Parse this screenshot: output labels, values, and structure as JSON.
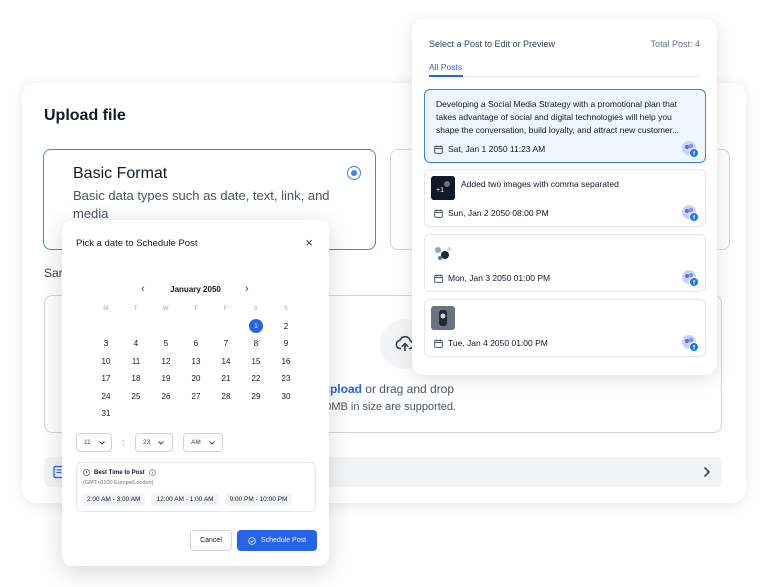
{
  "upload": {
    "title": "Upload file",
    "basic_format": {
      "name": "Basic Format",
      "description": "Basic data types such as date, text, link, and media"
    },
    "sample_label": "Sar",
    "dropzone": {
      "link_text": "o upload",
      "rest_text": " or drag and drop",
      "size_note": "o 50MB in size are supported."
    }
  },
  "posts": {
    "header_label": "Select a Post to Edit or Preview",
    "total_label": "Total Post: 4",
    "tab_all": "All Posts",
    "items": [
      {
        "text": "Developing a Social Media Strategy with a promotional plan that takes advantage of social and digital technologies will help you shape the conversation, build loyalty, and attract new customer...",
        "date": "Sat, Jan 1 2050 11:23 AM"
      },
      {
        "title": "Added two images with comma separated",
        "date": "Sun, Jan 2 2050 08:00 PM"
      },
      {
        "title": "",
        "date": "Mon, Jan 3 2050 01:00 PM"
      },
      {
        "title": "",
        "date": "Tue, Jan 4 2050 01:00 PM"
      }
    ],
    "thumb_badge": "+1"
  },
  "modal": {
    "title": "Pick a date to Schedule Post",
    "close": "×",
    "month": "January 2050",
    "weekdays": [
      "M",
      "T",
      "W",
      "T",
      "F",
      "S",
      "S"
    ],
    "weeks": [
      [
        "",
        "",
        "",
        "",
        "",
        "1",
        "2"
      ],
      [
        "3",
        "4",
        "5",
        "6",
        "7",
        "8",
        "9"
      ],
      [
        "10",
        "11",
        "12",
        "13",
        "14",
        "15",
        "16"
      ],
      [
        "17",
        "18",
        "19",
        "20",
        "21",
        "22",
        "23"
      ],
      [
        "24",
        "25",
        "26",
        "27",
        "28",
        "29",
        "30"
      ],
      [
        "31",
        "",
        "",
        "",
        "",
        "",
        ""
      ]
    ],
    "selected_day": "1",
    "time": {
      "hour": "11",
      "minute": "23",
      "period": "AM"
    },
    "best_time": {
      "title": "Best Time to Post",
      "timezone": "(GMT+0100 Europe/London)",
      "slots": [
        "2:00 AM - 3:00 AM",
        "12:00 AM - 1:00 AM",
        "9:00 PM - 10:00 PM"
      ]
    },
    "cancel_label": "Cancel",
    "schedule_label": "Schedule Post"
  },
  "colors": {
    "accent": "#2563eb",
    "accent_border": "#3b82f6",
    "selected_bg": "#eff6ff",
    "facebook": "#1877f2"
  }
}
